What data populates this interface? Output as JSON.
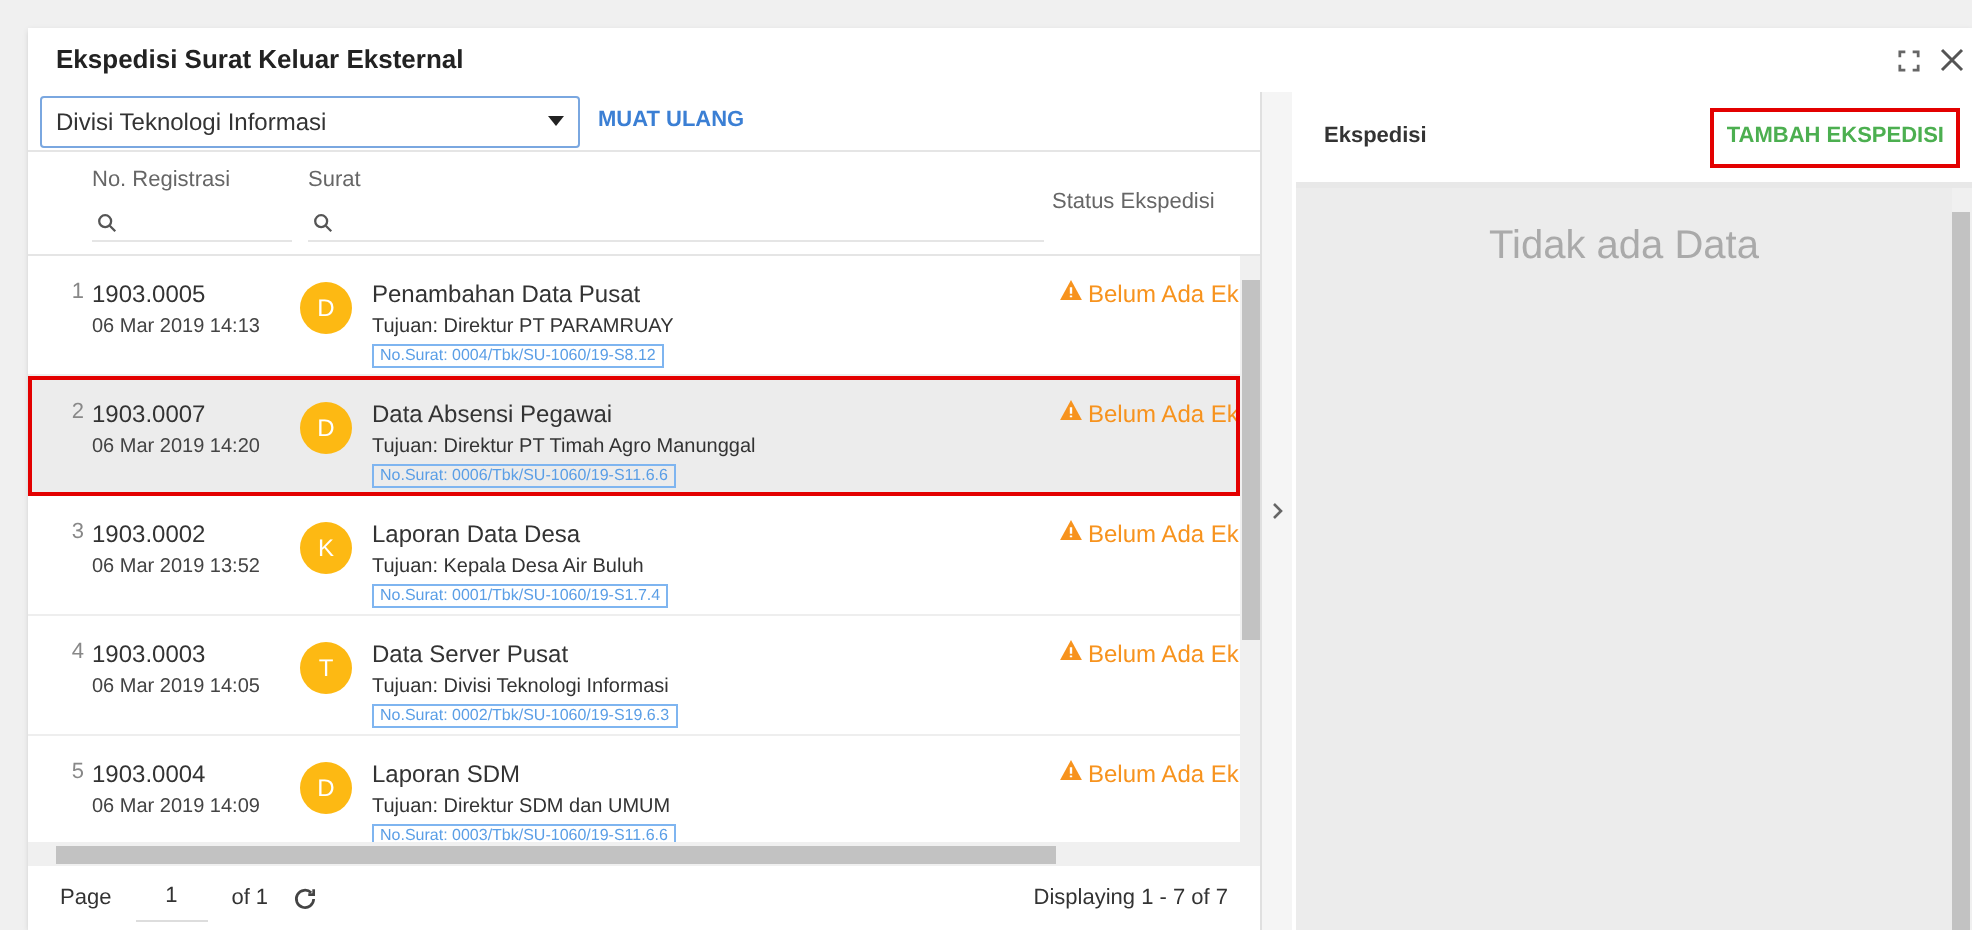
{
  "window": {
    "title": "Ekspedisi Surat Keluar Eksternal"
  },
  "filter": {
    "value": "Divisi Teknologi Informasi"
  },
  "reload_button": "MUAT ULANG",
  "table": {
    "columns": [
      "No. Registrasi",
      "Surat",
      "Status Ekspedisi"
    ],
    "rows": [
      {
        "index": "1",
        "reg_no": "1903.0005",
        "date": "06 Mar 2019 14:13",
        "avatar": "D",
        "title": "Penambahan Data Pusat",
        "recipient": "Tujuan: Direktur PT PARAMRUAY",
        "letter_no": "No.Surat: 0004/Tbk/SU-1060/19-S8.12",
        "status": "Belum Ada Ek",
        "selected": false,
        "highlighted": false
      },
      {
        "index": "2",
        "reg_no": "1903.0007",
        "date": "06 Mar 2019 14:20",
        "avatar": "D",
        "title": "Data Absensi Pegawai",
        "recipient": "Tujuan: Direktur PT Timah Agro Manunggal",
        "letter_no": "No.Surat: 0006/Tbk/SU-1060/19-S11.6.6",
        "status": "Belum Ada Ek",
        "selected": true,
        "highlighted": true
      },
      {
        "index": "3",
        "reg_no": "1903.0002",
        "date": "06 Mar 2019 13:52",
        "avatar": "K",
        "title": "Laporan Data Desa",
        "recipient": "Tujuan: Kepala Desa Air Buluh",
        "letter_no": "No.Surat: 0001/Tbk/SU-1060/19-S1.7.4",
        "status": "Belum Ada Ek",
        "selected": false,
        "highlighted": false
      },
      {
        "index": "4",
        "reg_no": "1903.0003",
        "date": "06 Mar 2019 14:05",
        "avatar": "T",
        "title": "Data Server Pusat",
        "recipient": "Tujuan: Divisi Teknologi Informasi",
        "letter_no": "No.Surat: 0002/Tbk/SU-1060/19-S19.6.3",
        "status": "Belum Ada Ek",
        "selected": false,
        "highlighted": false
      },
      {
        "index": "5",
        "reg_no": "1903.0004",
        "date": "06 Mar 2019 14:09",
        "avatar": "D",
        "title": "Laporan SDM",
        "recipient": "Tujuan: Direktur SDM dan UMUM",
        "letter_no": "No.Surat: 0003/Tbk/SU-1060/19-S11.6.6",
        "status": "Belum Ada Ek",
        "selected": false,
        "highlighted": false
      }
    ]
  },
  "pager": {
    "page_label": "Page",
    "page": "1",
    "of": "of 1",
    "summary": "Displaying 1 - 7 of 7"
  },
  "right_panel": {
    "title": "Ekspedisi",
    "add_button": {
      "label": "TAMBAH EKSPEDISI",
      "highlighted": true
    },
    "empty_text": "Tidak ada Data"
  }
}
